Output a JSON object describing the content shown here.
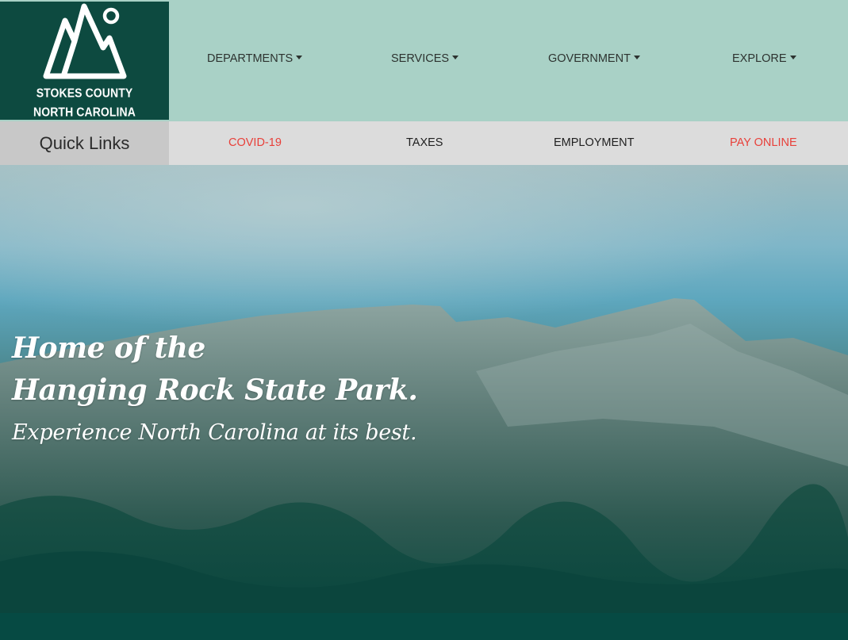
{
  "logo": {
    "line1": "STOKES COUNTY",
    "line2": "NORTH CAROLINA"
  },
  "nav": [
    {
      "label": "DEPARTMENTS"
    },
    {
      "label": "SERVICES"
    },
    {
      "label": "GOVERNMENT"
    },
    {
      "label": "EXPLORE"
    }
  ],
  "quick_links": {
    "title": "Quick Links",
    "items": [
      {
        "label": "COVID-19",
        "color": "#e8403a"
      },
      {
        "label": "TAXES",
        "color": "#1f1f1f"
      },
      {
        "label": "EMPLOYMENT",
        "color": "#1f1f1f"
      },
      {
        "label": "PAY ONLINE",
        "color": "#e8403a"
      }
    ]
  },
  "hero": {
    "line1": "Home of the",
    "line2": "Hanging Rock State Park.",
    "line3": "Experience North Carolina at its best."
  },
  "colors": {
    "header_bg": "#a9d1c6",
    "logo_bg": "#0d4a40",
    "accent_red": "#e8403a",
    "footer": "#064a43"
  }
}
